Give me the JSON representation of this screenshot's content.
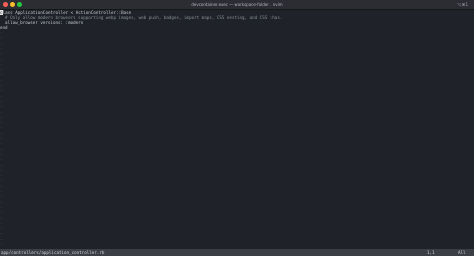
{
  "window": {
    "title": "devcontainer.exec — workspace-folder . nvim",
    "badge": "⌥⌘1"
  },
  "editor": {
    "lines": [
      {
        "cursor_char": "c",
        "text": "lass ApplicationController < ActionController::Base"
      },
      {
        "text": "  # Only allow modern browsers supporting webp images, web push, badges, import maps, CSS nesting, and CSS :has."
      },
      {
        "text": "  allow_browser versions: :modern"
      },
      {
        "text": "end"
      }
    ],
    "empty_line_marker": "~"
  },
  "statusline": {
    "filename": "app/controllers/application_controller.rb",
    "position": "1,1",
    "scroll": "All"
  }
}
